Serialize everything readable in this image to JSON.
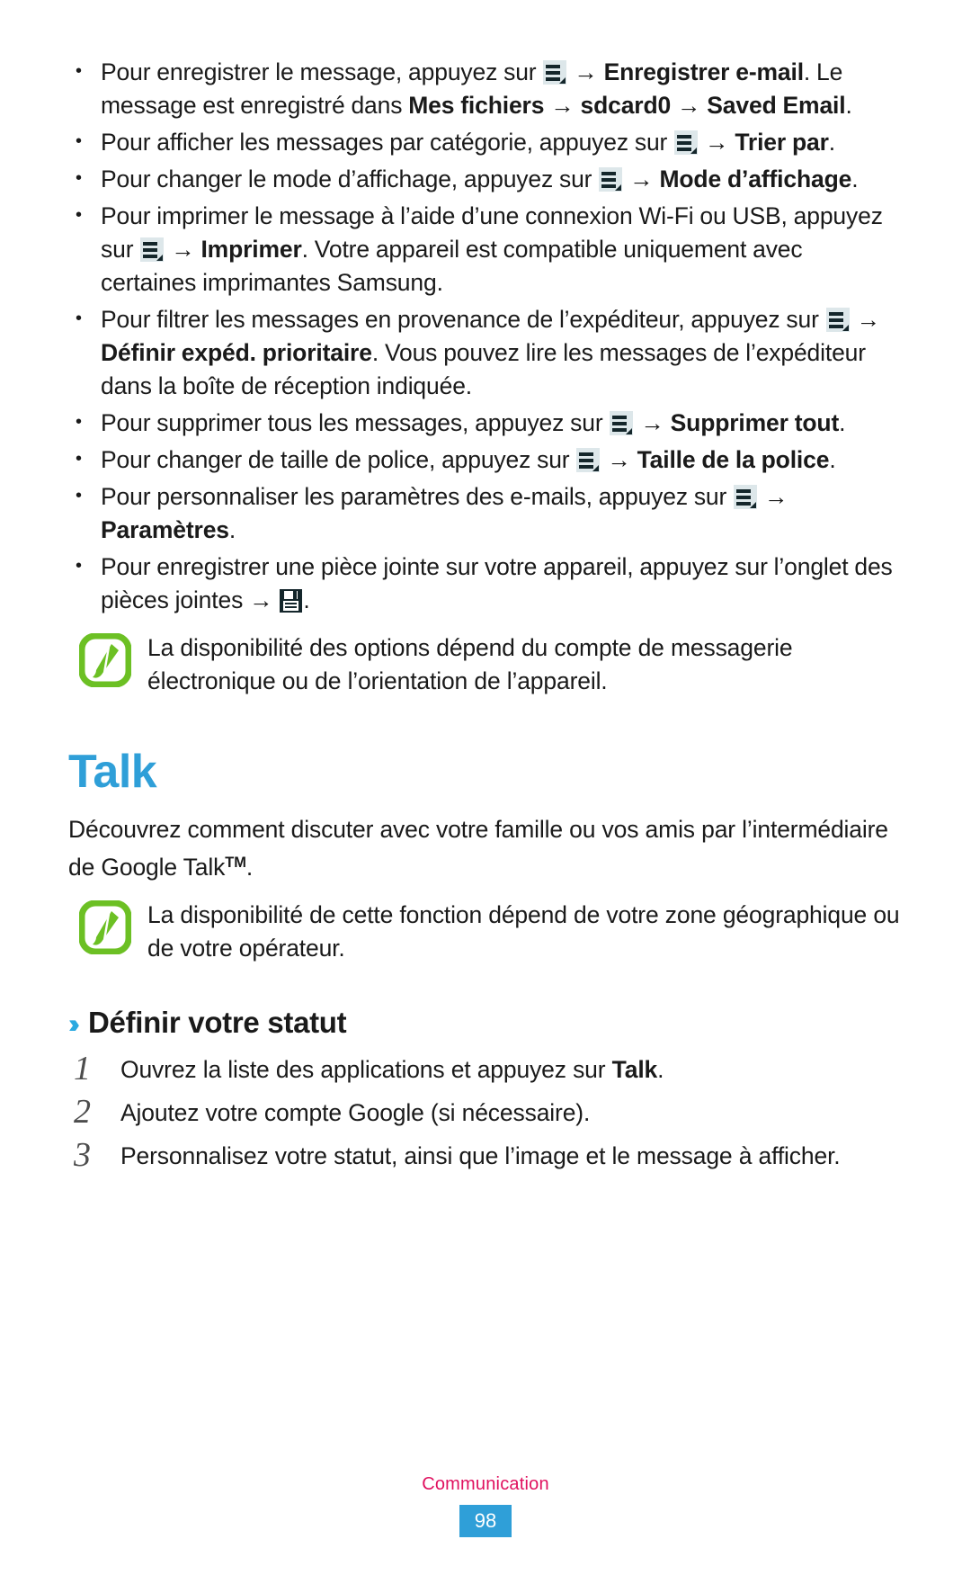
{
  "colors": {
    "heading_blue": "#2f9fd8",
    "chevron_blue": "#2aa9e0",
    "note_green": "#6cc024",
    "footer_label": "#e0115f",
    "page_badge_bg": "#2f9fd8",
    "menu_icon_bg": "#dde7ea",
    "menu_icon_fg": "#14262b",
    "step_number": "#4d4d4d"
  },
  "bullets": [
    {
      "id": "save-email",
      "parts": [
        {
          "t": "text",
          "v": "Pour enregistrer le message, appuyez sur "
        },
        {
          "t": "icon",
          "v": "menu-icon"
        },
        {
          "t": "text",
          "v": " → "
        },
        {
          "t": "bold",
          "v": "Enregistrer e-mail"
        },
        {
          "t": "text",
          "v": ". Le message est enregistré dans "
        },
        {
          "t": "bold",
          "v": "Mes fichiers"
        },
        {
          "t": "text",
          "v": " → "
        },
        {
          "t": "bold",
          "v": "sdcard0"
        },
        {
          "t": "text",
          "v": " → "
        },
        {
          "t": "bold",
          "v": "Saved Email"
        },
        {
          "t": "text",
          "v": "."
        }
      ]
    },
    {
      "id": "sort-by",
      "parts": [
        {
          "t": "text",
          "v": "Pour afficher les messages par catégorie, appuyez sur "
        },
        {
          "t": "icon",
          "v": "menu-icon"
        },
        {
          "t": "text",
          "v": " → "
        },
        {
          "t": "bold",
          "v": "Trier par"
        },
        {
          "t": "text",
          "v": "."
        }
      ]
    },
    {
      "id": "view-mode",
      "parts": [
        {
          "t": "text",
          "v": "Pour changer le mode d’affichage, appuyez sur "
        },
        {
          "t": "icon",
          "v": "menu-icon"
        },
        {
          "t": "text",
          "v": " → "
        },
        {
          "t": "bold",
          "v": "Mode d’affichage"
        },
        {
          "t": "text",
          "v": "."
        }
      ]
    },
    {
      "id": "print",
      "parts": [
        {
          "t": "text",
          "v": "Pour imprimer le message à l’aide d’une connexion Wi-Fi ou USB, appuyez sur "
        },
        {
          "t": "icon",
          "v": "menu-icon"
        },
        {
          "t": "text",
          "v": " → "
        },
        {
          "t": "bold",
          "v": "Imprimer"
        },
        {
          "t": "text",
          "v": ". Votre appareil est compatible uniquement avec certaines imprimantes Samsung."
        }
      ]
    },
    {
      "id": "priority-sender",
      "parts": [
        {
          "t": "text",
          "v": "Pour filtrer les messages en provenance de l’expéditeur, appuyez sur "
        },
        {
          "t": "icon",
          "v": "menu-icon"
        },
        {
          "t": "text",
          "v": " → "
        },
        {
          "t": "bold",
          "v": "Définir expéd. prioritaire"
        },
        {
          "t": "text",
          "v": ". Vous pouvez lire les messages de l’expéditeur dans la boîte de réception indiquée."
        }
      ]
    },
    {
      "id": "delete-all",
      "parts": [
        {
          "t": "text",
          "v": "Pour supprimer tous les messages, appuyez sur "
        },
        {
          "t": "icon",
          "v": "menu-icon"
        },
        {
          "t": "text",
          "v": " → "
        },
        {
          "t": "bold",
          "v": "Supprimer tout"
        },
        {
          "t": "text",
          "v": "."
        }
      ]
    },
    {
      "id": "font-size",
      "parts": [
        {
          "t": "text",
          "v": "Pour changer de taille de police, appuyez sur "
        },
        {
          "t": "icon",
          "v": "menu-icon"
        },
        {
          "t": "text",
          "v": " → "
        },
        {
          "t": "bold",
          "v": "Taille de la police"
        },
        {
          "t": "text",
          "v": "."
        }
      ]
    },
    {
      "id": "settings",
      "parts": [
        {
          "t": "text",
          "v": "Pour personnaliser les paramètres des e-mails, appuyez sur "
        },
        {
          "t": "icon",
          "v": "menu-icon"
        },
        {
          "t": "text",
          "v": " → "
        },
        {
          "t": "bold",
          "v": "Paramètres"
        },
        {
          "t": "text",
          "v": "."
        }
      ]
    },
    {
      "id": "save-attachment",
      "parts": [
        {
          "t": "text",
          "v": "Pour enregistrer une pièce jointe sur votre appareil, appuyez sur l’onglet des pièces jointes → "
        },
        {
          "t": "icon",
          "v": "save-icon"
        },
        {
          "t": "text",
          "v": "."
        }
      ]
    }
  ],
  "note_email": {
    "icon": "note-pencil-icon",
    "text": "La disponibilité des options dépend du compte de messagerie électronique ou de l’orientation de l’appareil."
  },
  "chapter": {
    "title": "Talk",
    "intro_before_tm": "Découvrez comment discuter avec votre famille ou vos amis par l’intermédiaire de Google Talk",
    "intro_tm": "TM",
    "intro_after_tm": "."
  },
  "note_talk": {
    "icon": "note-pencil-icon",
    "text": "La disponibilité de cette fonction dépend de votre zone géographique ou de votre opérateur."
  },
  "section": {
    "chevron": "››",
    "title": "Définir votre statut"
  },
  "steps": [
    {
      "num": "1",
      "parts": [
        {
          "t": "text",
          "v": "Ouvrez la liste des applications et appuyez sur "
        },
        {
          "t": "bold",
          "v": "Talk"
        },
        {
          "t": "text",
          "v": "."
        }
      ]
    },
    {
      "num": "2",
      "parts": [
        {
          "t": "text",
          "v": "Ajoutez votre compte Google (si nécessaire)."
        }
      ]
    },
    {
      "num": "3",
      "parts": [
        {
          "t": "text",
          "v": "Personnalisez votre statut, ainsi que l’image et le message à afficher."
        }
      ]
    }
  ],
  "footer": {
    "label": "Communication",
    "page_number": "98"
  }
}
